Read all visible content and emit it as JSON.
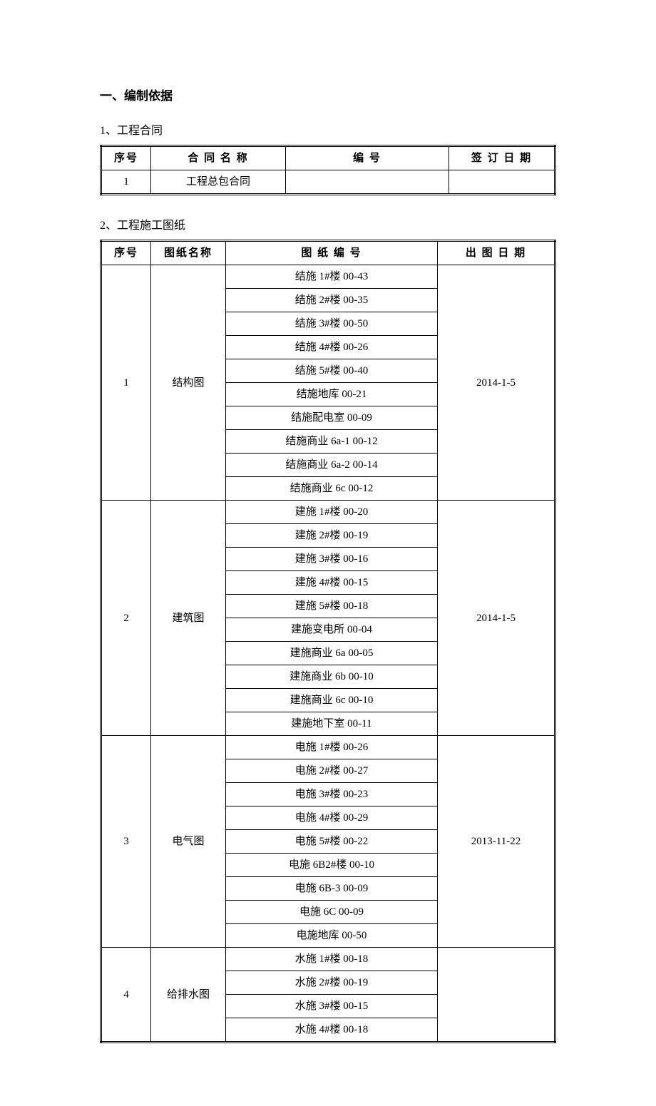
{
  "heading": "一、编制依据",
  "section1": {
    "title": "1、工程合同",
    "headers": {
      "seq": "序号",
      "name": "合 同 名 称",
      "num": "编   号",
      "date": "签 订 日 期"
    },
    "rows": [
      {
        "seq": "1",
        "name": "工程总包合同",
        "num": "",
        "date": ""
      }
    ]
  },
  "section2": {
    "title": "2、工程施工图纸",
    "headers": {
      "seq": "序号",
      "name": "图纸名称",
      "num": "图 纸 编 号",
      "date": "出 图 日 期"
    },
    "groups": [
      {
        "seq": "1",
        "name": "结构图",
        "date": "2014-1-5",
        "items": [
          "结施 1#楼 00-43",
          "结施 2#楼 00-35",
          "结施 3#楼 00-50",
          "结施 4#楼 00-26",
          "结施 5#楼 00-40",
          "结施地库 00-21",
          "结施配电室 00-09",
          "结施商业 6a-1 00-12",
          "结施商业 6a-2 00-14",
          "结施商业 6c 00-12"
        ]
      },
      {
        "seq": "2",
        "name": "建筑图",
        "date": "2014-1-5",
        "items": [
          "建施 1#楼 00-20",
          "建施 2#楼 00-19",
          "建施 3#楼 00-16",
          "建施 4#楼 00-15",
          "建施 5#楼 00-18",
          "建施变电所 00-04",
          "建施商业 6a 00-05",
          "建施商业 6b 00-10",
          "建施商业 6c 00-10",
          "建施地下室 00-11"
        ]
      },
      {
        "seq": "3",
        "name": "电气图",
        "date": "2013-11-22",
        "items": [
          "电施 1#楼 00-26",
          "电施 2#楼 00-27",
          "电施 3#楼 00-23",
          "电施 4#楼 00-29",
          "电施 5#楼 00-22",
          "电施 6B2#楼 00-10",
          "电施 6B-3 00-09",
          "电施 6C 00-09",
          "电施地库 00-50"
        ]
      },
      {
        "seq": "4",
        "name": "给排水图",
        "date": "",
        "items": [
          "水施 1#楼 00-18",
          "水施 2#楼 00-19",
          "水施 3#楼 00-15",
          "水施 4#楼 00-18"
        ]
      }
    ]
  }
}
